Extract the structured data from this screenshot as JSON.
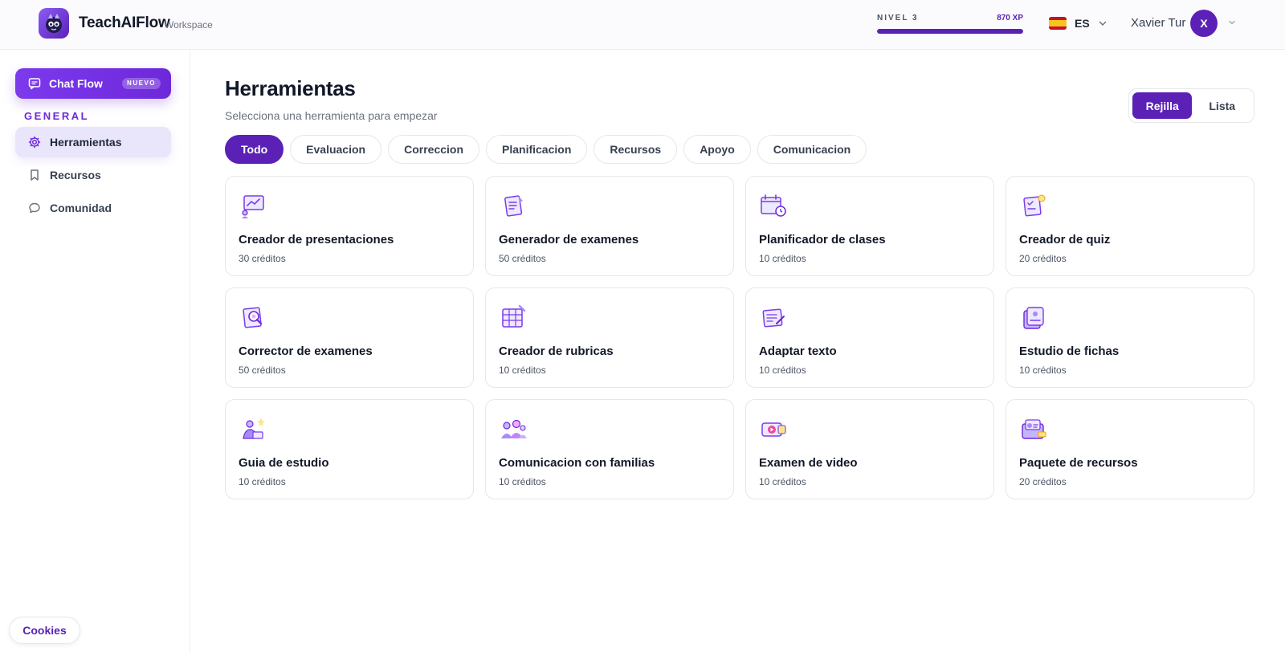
{
  "header": {
    "brand": "TeachAIFlow",
    "brand_sub": "Workspace",
    "level_label": "NIVEL 3",
    "xp_label": "870 XP",
    "xp_progress": 1.0,
    "language": "ES",
    "user_name": "Xavier Tur",
    "avatar_initial": "X"
  },
  "sidebar": {
    "chat_button": {
      "label": "Chat Flow",
      "badge": "NUEVO"
    },
    "section_title": "GENERAL",
    "items": [
      {
        "label": "Herramientas",
        "icon": "gear-icon",
        "active": true
      },
      {
        "label": "Recursos",
        "icon": "bookmark-icon",
        "active": false
      },
      {
        "label": "Comunidad",
        "icon": "chat-bubble-icon",
        "active": false
      }
    ],
    "cookies_label": "Cookies"
  },
  "main": {
    "title": "Herramientas",
    "subtitle": "Selecciona una herramienta para empezar",
    "view_toggle": {
      "grid": "Rejilla",
      "list": "Lista",
      "selected": "grid"
    },
    "tabs": [
      "Todo",
      "Evaluacion",
      "Correccion",
      "Planificacion",
      "Recursos",
      "Apoyo",
      "Comunicacion"
    ],
    "active_tab": 0,
    "tools": [
      {
        "name": "Creador de presentaciones",
        "credits": "30 créditos",
        "icon": "presentation-icon"
      },
      {
        "name": "Generador de examenes",
        "credits": "50 créditos",
        "icon": "exam-icon"
      },
      {
        "name": "Planificador de clases",
        "credits": "10 créditos",
        "icon": "calendar-icon"
      },
      {
        "name": "Creador de quiz",
        "credits": "20 créditos",
        "icon": "quiz-icon"
      },
      {
        "name": "Corrector de examenes",
        "credits": "50 créditos",
        "icon": "grader-icon"
      },
      {
        "name": "Creador de rubricas",
        "credits": "10 créditos",
        "icon": "rubric-icon"
      },
      {
        "name": "Adaptar texto",
        "credits": "10 créditos",
        "icon": "text-edit-icon"
      },
      {
        "name": "Estudio de fichas",
        "credits": "10 créditos",
        "icon": "flashcards-icon"
      },
      {
        "name": "Guia de estudio",
        "credits": "10 créditos",
        "icon": "study-guide-icon"
      },
      {
        "name": "Comunicacion con familias",
        "credits": "10 créditos",
        "icon": "family-icon"
      },
      {
        "name": "Examen de video",
        "credits": "10 créditos",
        "icon": "video-icon"
      },
      {
        "name": "Paquete de recursos",
        "credits": "20 créditos",
        "icon": "resource-pack-icon"
      }
    ]
  },
  "colors": {
    "accent": "#5b21b6",
    "accent_light": "#e9e6fb",
    "text": "#111827",
    "muted": "#6b7280"
  }
}
